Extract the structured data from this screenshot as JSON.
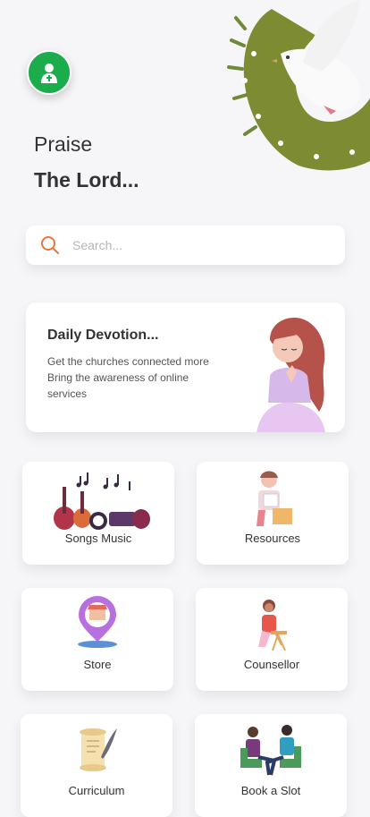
{
  "header": {
    "greeting": "Praise",
    "title": "The Lord..."
  },
  "search": {
    "placeholder": "Search..."
  },
  "devotion": {
    "title": "Daily Devotion...",
    "description_line1": "Get the churches connected more",
    "description_line2": "Bring the awareness of online",
    "description_line3": "services"
  },
  "menu": [
    {
      "label": "Songs Music",
      "icon": "music-instruments-icon"
    },
    {
      "label": "Resources",
      "icon": "reading-girl-icon"
    },
    {
      "label": "Store",
      "icon": "store-pin-icon"
    },
    {
      "label": "Counsellor",
      "icon": "counsellor-icon"
    },
    {
      "label": "Curriculum",
      "icon": "scroll-quill-icon"
    },
    {
      "label": "Book a Slot",
      "icon": "meeting-chairs-icon"
    }
  ],
  "colors": {
    "accent_green": "#1bac4b",
    "search_icon": "#e8773a",
    "wreath": "#7a8a2f"
  }
}
